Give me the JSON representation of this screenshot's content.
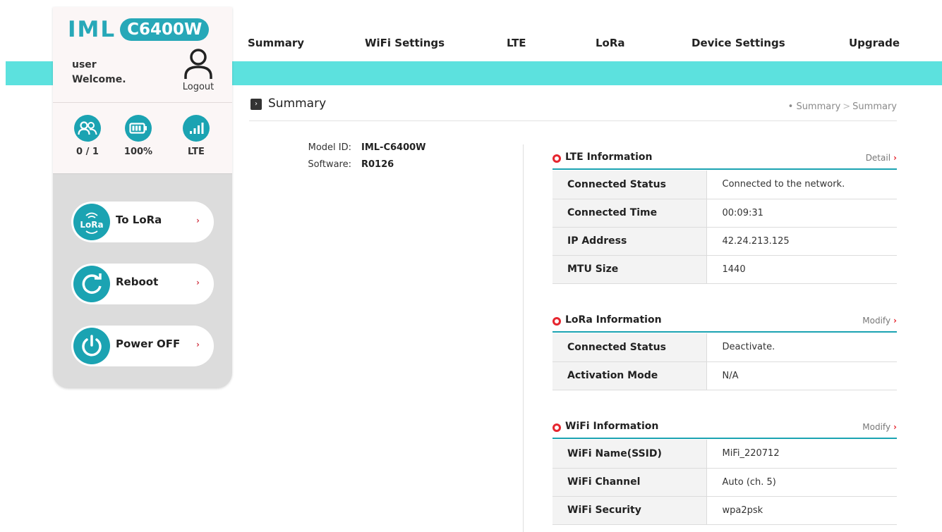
{
  "brand": {
    "name": "IML",
    "model": "C6400W"
  },
  "user": {
    "name": "user",
    "welcome": "Welcome.",
    "logout_label": "Logout"
  },
  "stats": [
    {
      "icon": "users-icon",
      "label": "0 / 1"
    },
    {
      "icon": "battery-icon",
      "label": "100%"
    },
    {
      "icon": "signal-icon",
      "label": "LTE"
    }
  ],
  "side_buttons": [
    {
      "icon": "lora-icon",
      "icon_text": "LoRa",
      "label": "To LoRa"
    },
    {
      "icon": "reboot-icon",
      "label": "Reboot"
    },
    {
      "icon": "power-icon",
      "label": "Power OFF"
    }
  ],
  "nav": [
    "Summary",
    "WiFi Settings",
    "LTE",
    "LoRa",
    "Device Settings",
    "Upgrade"
  ],
  "page": {
    "title": "Summary",
    "breadcrumb": [
      "Summary",
      "Summary"
    ]
  },
  "device": {
    "model_label": "Model ID:",
    "model_value": "IML-C6400W",
    "software_label": "Software:",
    "software_value": "R0126"
  },
  "sections": {
    "lte": {
      "title": "LTE Information",
      "link": "Detail",
      "rows": [
        {
          "key": "Connected Status",
          "value": "Connected to the network."
        },
        {
          "key": "Connected Time",
          "value": "00:09:31"
        },
        {
          "key": "IP Address",
          "value": "42.24.213.125"
        },
        {
          "key": "MTU Size",
          "value": "1440"
        }
      ]
    },
    "lora": {
      "title": "LoRa Information",
      "link": "Modify",
      "rows": [
        {
          "key": "Connected Status",
          "value": "Deactivate."
        },
        {
          "key": "Activation Mode",
          "value": "N/A"
        }
      ]
    },
    "wifi": {
      "title": "WiFi Information",
      "link": "Modify",
      "rows": [
        {
          "key": "WiFi Name(SSID)",
          "value": "MiFi_220712"
        },
        {
          "key": "WiFi Channel",
          "value": "Auto (ch. 5)"
        },
        {
          "key": "WiFi Security",
          "value": "wpa2psk"
        }
      ]
    }
  },
  "colors": {
    "accent": "#1ba3b2",
    "band": "#5ce1de",
    "marker": "#e6262f"
  }
}
